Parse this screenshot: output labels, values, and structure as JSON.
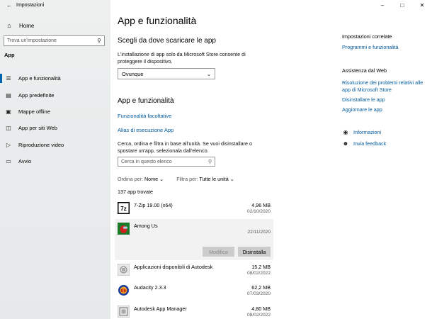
{
  "window": {
    "title": "Impostazioni",
    "back_icon": "back-arrow-icon",
    "controls": [
      "minimize-icon",
      "maximize-icon",
      "close-icon"
    ]
  },
  "sidebar": {
    "home_label": "Home",
    "search_placeholder": "Trova un'impostazione",
    "section_label": "App",
    "items": [
      {
        "label": "App e funzionalità",
        "icon": "apps-list-icon",
        "active": true
      },
      {
        "label": "App predefinite",
        "icon": "default-apps-icon",
        "active": false
      },
      {
        "label": "Mappe offline",
        "icon": "map-icon",
        "active": false
      },
      {
        "label": "App per siti Web",
        "icon": "website-apps-icon",
        "active": false
      },
      {
        "label": "Riproduzione video",
        "icon": "video-icon",
        "active": false
      },
      {
        "label": "Avvio",
        "icon": "startup-icon",
        "active": false
      }
    ]
  },
  "main": {
    "title": "App e funzionalità",
    "source_heading": "Scegli da dove scaricare le app",
    "source_desc": "L'installazione di app solo da Microsoft Store consente di proteggere il dispositivo.",
    "source_value": "Ovunque",
    "apps_heading": "App e funzionalità",
    "link_optional": "Funzionalità facoltative",
    "link_alias": "Alias di esecuzione App",
    "search_desc": "Cerca, ordina e filtra in base all'unità. Se vuoi disinstallare o spostare un'app, selezionala dall'elenco.",
    "search_placeholder": "Cerca in questo elenco",
    "sort_label": "Ordina per:",
    "sort_value": "Nome",
    "filter_label": "Filtra per:",
    "filter_value": "Tutte le unità",
    "count_text": "137 app trovate",
    "apps": [
      {
        "name": "7-Zip 19.00 (x64)",
        "size": "4,96 MB",
        "date": "02/10/2020",
        "icon": "7zip-icon"
      },
      {
        "name": "Among Us",
        "size": "",
        "date": "22/11/2020",
        "icon": "among-us-icon",
        "selected": true
      },
      {
        "name": "Applicazioni disponibili di Autodesk",
        "size": "15,2 MB",
        "date": "08/02/2022",
        "icon": "autodesk-apps-icon"
      },
      {
        "name": "Audacity 2.3.3",
        "size": "62,2 MB",
        "date": "07/03/2020",
        "icon": "audacity-icon"
      },
      {
        "name": "Autodesk App Manager",
        "size": "4,80 MB",
        "date": "08/02/2022",
        "icon": "autodesk-manager-icon"
      }
    ],
    "btn_modify": "Modifica",
    "btn_uninstall": "Disinstalla"
  },
  "related": {
    "heading": "Impostazioni correlate",
    "link1": "Programmi e funzionalità",
    "help_heading": "Assistenza dal Web",
    "help_link1": "Risoluzione dei problemi relativi alle app di Microsoft Store",
    "help_link2": "Disinstallare le app",
    "help_link3": "Aggiornare le app",
    "info": "Informazioni",
    "feedback": "Invia feedback"
  }
}
